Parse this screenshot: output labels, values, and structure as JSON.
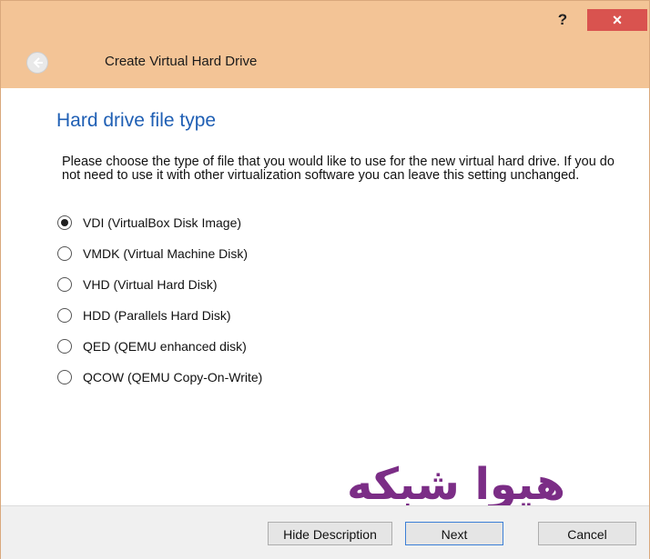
{
  "titlebar": {
    "help_label": "?",
    "close_label": "×"
  },
  "header": {
    "title": "Create Virtual Hard Drive"
  },
  "page": {
    "title": "Hard drive file type",
    "description": "Please choose the type of file that you would like to use for the new virtual hard drive. If you do not need to use it with other virtualization software you can leave this setting unchanged."
  },
  "options": [
    {
      "label": "VDI (VirtualBox Disk Image)",
      "checked": true
    },
    {
      "label": "VMDK (Virtual Machine Disk)",
      "checked": false
    },
    {
      "label": "VHD (Virtual Hard Disk)",
      "checked": false
    },
    {
      "label": "HDD (Parallels Hard Disk)",
      "checked": false
    },
    {
      "label": "QED (QEMU enhanced disk)",
      "checked": false
    },
    {
      "label": "QCOW (QEMU Copy-On-Write)",
      "checked": false
    }
  ],
  "watermark": {
    "text": "هیوا شبکه",
    "color": "#7b2d86"
  },
  "buttons": {
    "hide_description": "Hide Description",
    "next": "Next",
    "cancel": "Cancel"
  }
}
